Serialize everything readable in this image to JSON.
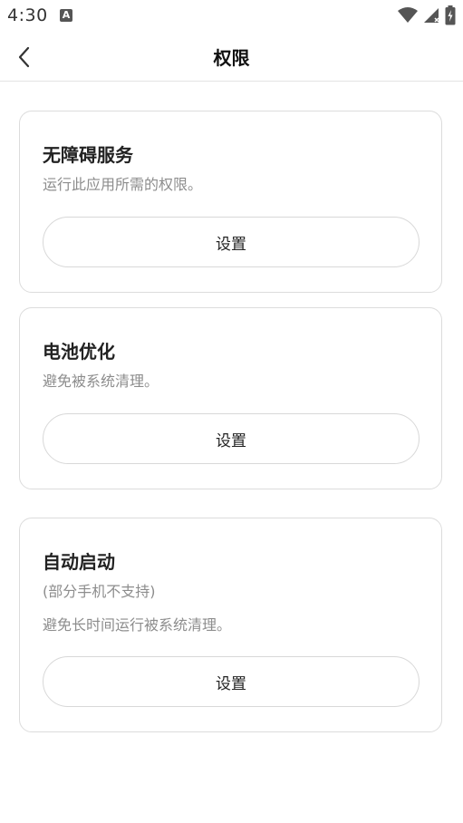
{
  "status_bar": {
    "time": "4:30",
    "notification_icon": "a-icon",
    "icons": [
      "wifi-icon",
      "signal-icon",
      "battery-icon"
    ]
  },
  "app_bar": {
    "back_icon": "chevron-left-icon",
    "title": "权限"
  },
  "cards": [
    {
      "title": "无障碍服务",
      "description": "运行此应用所需的权限。",
      "button_label": "设置"
    },
    {
      "title": "电池优化",
      "description": "避免被系统清理。",
      "button_label": "设置"
    },
    {
      "title": "自动启动",
      "subtitle": "(部分手机不支持)",
      "description": "避免长时间运行被系统清理。",
      "button_label": "设置"
    }
  ]
}
